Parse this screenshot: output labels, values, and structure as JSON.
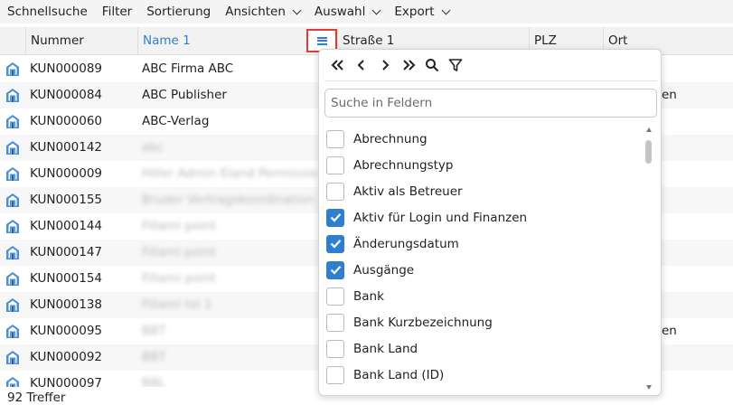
{
  "toolbar": {
    "items": [
      {
        "label": "Schnellsuche",
        "dropdown": false
      },
      {
        "label": "Filter",
        "dropdown": false
      },
      {
        "label": "Sortierung",
        "dropdown": false
      },
      {
        "label": "Ansichten",
        "dropdown": true
      },
      {
        "label": "Auswahl",
        "dropdown": true
      },
      {
        "label": "Export",
        "dropdown": true
      }
    ]
  },
  "table": {
    "columns": [
      "Nummer",
      "Name 1",
      "Straße 1",
      "PLZ",
      "Ort"
    ],
    "active_sort_column": "Name 1",
    "accent_color": "#2f7fd0",
    "rows": [
      {
        "nummer": "KUN000089",
        "name": "ABC Firma ABC",
        "ort": ""
      },
      {
        "nummer": "KUN000084",
        "name": "ABC Publisher",
        "ort": "en"
      },
      {
        "nummer": "KUN000060",
        "name": "ABC-Verlag",
        "ort": ""
      },
      {
        "nummer": "KUN000142",
        "name": "",
        "ort": "",
        "blurred": "abc"
      },
      {
        "nummer": "KUN000009",
        "name": "",
        "ort": "",
        "blurred": "Hiller Admin Eland Permission s"
      },
      {
        "nummer": "KUN000155",
        "name": "",
        "ort": "",
        "blurred": "Bruder Vertragskoordination GmbH"
      },
      {
        "nummer": "KUN000144",
        "name": "",
        "ort": "",
        "blurred": "Fillami point"
      },
      {
        "nummer": "KUN000147",
        "name": "",
        "ort": "",
        "blurred": "Fillami point"
      },
      {
        "nummer": "KUN000154",
        "name": "",
        "ort": "",
        "blurred": "Fillami point"
      },
      {
        "nummer": "KUN000138",
        "name": "",
        "ort": "",
        "blurred": "Fillami tel 1"
      },
      {
        "nummer": "KUN000095",
        "name": "",
        "ort": "en",
        "blurred": "BBT"
      },
      {
        "nummer": "KUN000092",
        "name": "",
        "ort": "",
        "blurred": "BBT"
      },
      {
        "nummer": "KUN000097",
        "name": "",
        "ort": "",
        "blurred": "BBL"
      }
    ]
  },
  "status": {
    "text": "92 Treffer"
  },
  "column_chooser": {
    "nav_icons": [
      "first-page-icon",
      "prev-icon",
      "next-icon",
      "last-page-icon",
      "search-icon",
      "filter-icon"
    ],
    "search_placeholder": "Suche in Feldern",
    "fields": [
      {
        "label": "Abrechnung",
        "checked": false
      },
      {
        "label": "Abrechnungstyp",
        "checked": false
      },
      {
        "label": "Aktiv als Betreuer",
        "checked": false
      },
      {
        "label": "Aktiv für Login und Finanzen",
        "checked": true
      },
      {
        "label": "Änderungsdatum",
        "checked": true
      },
      {
        "label": "Ausgänge",
        "checked": true
      },
      {
        "label": "Bank",
        "checked": false
      },
      {
        "label": "Bank Kurzbezeichnung",
        "checked": false
      },
      {
        "label": "Bank Land",
        "checked": false
      },
      {
        "label": "Bank Land (ID)",
        "checked": false
      }
    ]
  }
}
